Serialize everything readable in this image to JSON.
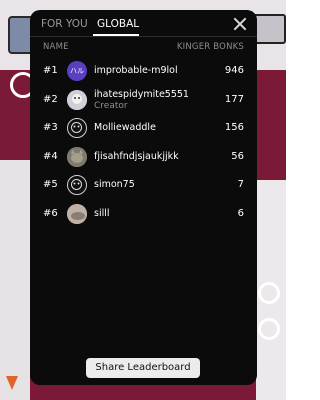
{
  "tabs": [
    {
      "label": "FOR YOU",
      "active": false
    },
    {
      "label": "GLOBAL",
      "active": true
    }
  ],
  "columns": {
    "name": "NAME",
    "score": "KINGER BONKS"
  },
  "rows": [
    {
      "rank": "#1",
      "avatar_text": "ハル",
      "username": "improbable-m9lol",
      "subtitle": "",
      "score": "946"
    },
    {
      "rank": "#2",
      "avatar_text": "",
      "username": "ihatespidymite5551",
      "subtitle": "Creator",
      "score": "177"
    },
    {
      "rank": "#3",
      "avatar_text": "",
      "username": "Molliewaddle",
      "subtitle": "",
      "score": "156"
    },
    {
      "rank": "#4",
      "avatar_text": "",
      "username": "fjisahfndjsjaukjjkk",
      "subtitle": "",
      "score": "56"
    },
    {
      "rank": "#5",
      "avatar_text": "",
      "username": "simon75",
      "subtitle": "",
      "score": "7"
    },
    {
      "rank": "#6",
      "avatar_text": "",
      "username": "silll",
      "subtitle": "",
      "score": "6"
    }
  ],
  "share_button": "Share Leaderboard",
  "icons": {
    "close": "close-icon"
  },
  "colors": {
    "modal_bg": "#0b0b0b",
    "button_bg": "#ececec",
    "muted_text": "#8d8d8d"
  }
}
